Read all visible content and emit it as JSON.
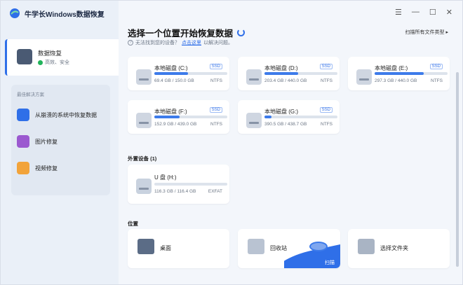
{
  "app": {
    "title": "牛学长Windows数据恢复"
  },
  "window_controls": {
    "menu": "☰",
    "minimize": "—",
    "maximize": "☐",
    "close": "✕"
  },
  "sidebar": {
    "recover": {
      "label": "数据恢复",
      "status": "高效、安全"
    },
    "solutions_title": "最佳解决方案",
    "solutions": [
      {
        "label": "从崩溃的系统中恢复数据"
      },
      {
        "label": "图片修复"
      },
      {
        "label": "视频修复"
      }
    ]
  },
  "main": {
    "title": "选择一个位置开始恢复数据",
    "hint_prefix": "无法找到您的设备？",
    "hint_link": "点击这里",
    "hint_suffix": "以解决问题。",
    "scan_types": "扫描所有文件类型 ▸",
    "disks": [
      {
        "name": "本地磁盘 (C:)",
        "badge": "SSD",
        "size": "69.4 GB / 150.0 GB",
        "fs": "NTFS",
        "usage": 0.46
      },
      {
        "name": "本地磁盘 (D:)",
        "badge": "SSD",
        "size": "203.4 GB / 440.0 GB",
        "fs": "NTFS",
        "usage": 0.46
      },
      {
        "name": "本地磁盘 (E:)",
        "badge": "SSD",
        "size": "297.3 GB / 440.0 GB",
        "fs": "NTFS",
        "usage": 0.67
      },
      {
        "name": "本地磁盘 (F:)",
        "badge": "SSD",
        "size": "152.9 GB / 439.0 GB",
        "fs": "NTFS",
        "usage": 0.35
      },
      {
        "name": "本地磁盘 (G:)",
        "badge": "SSD",
        "size": "390.5 GB / 438.7 GB",
        "fs": "NTFS",
        "usage": 0.1
      }
    ],
    "external_title": "外置设备 (1)",
    "usb": {
      "name": "U 盘 (H:)",
      "size": "116.3 GB / 116.4 GB",
      "fs": "EXFAT",
      "usage": 0.0
    },
    "location_title": "位置",
    "locations": [
      {
        "label": "桌面"
      },
      {
        "label": "回收站",
        "action": "扫描"
      },
      {
        "label": "选择文件夹"
      }
    ]
  },
  "colors": {
    "accent": "#2f6fe8",
    "sidebar_bg": "#eaf0f8",
    "main_bg": "#f3f6fb"
  }
}
